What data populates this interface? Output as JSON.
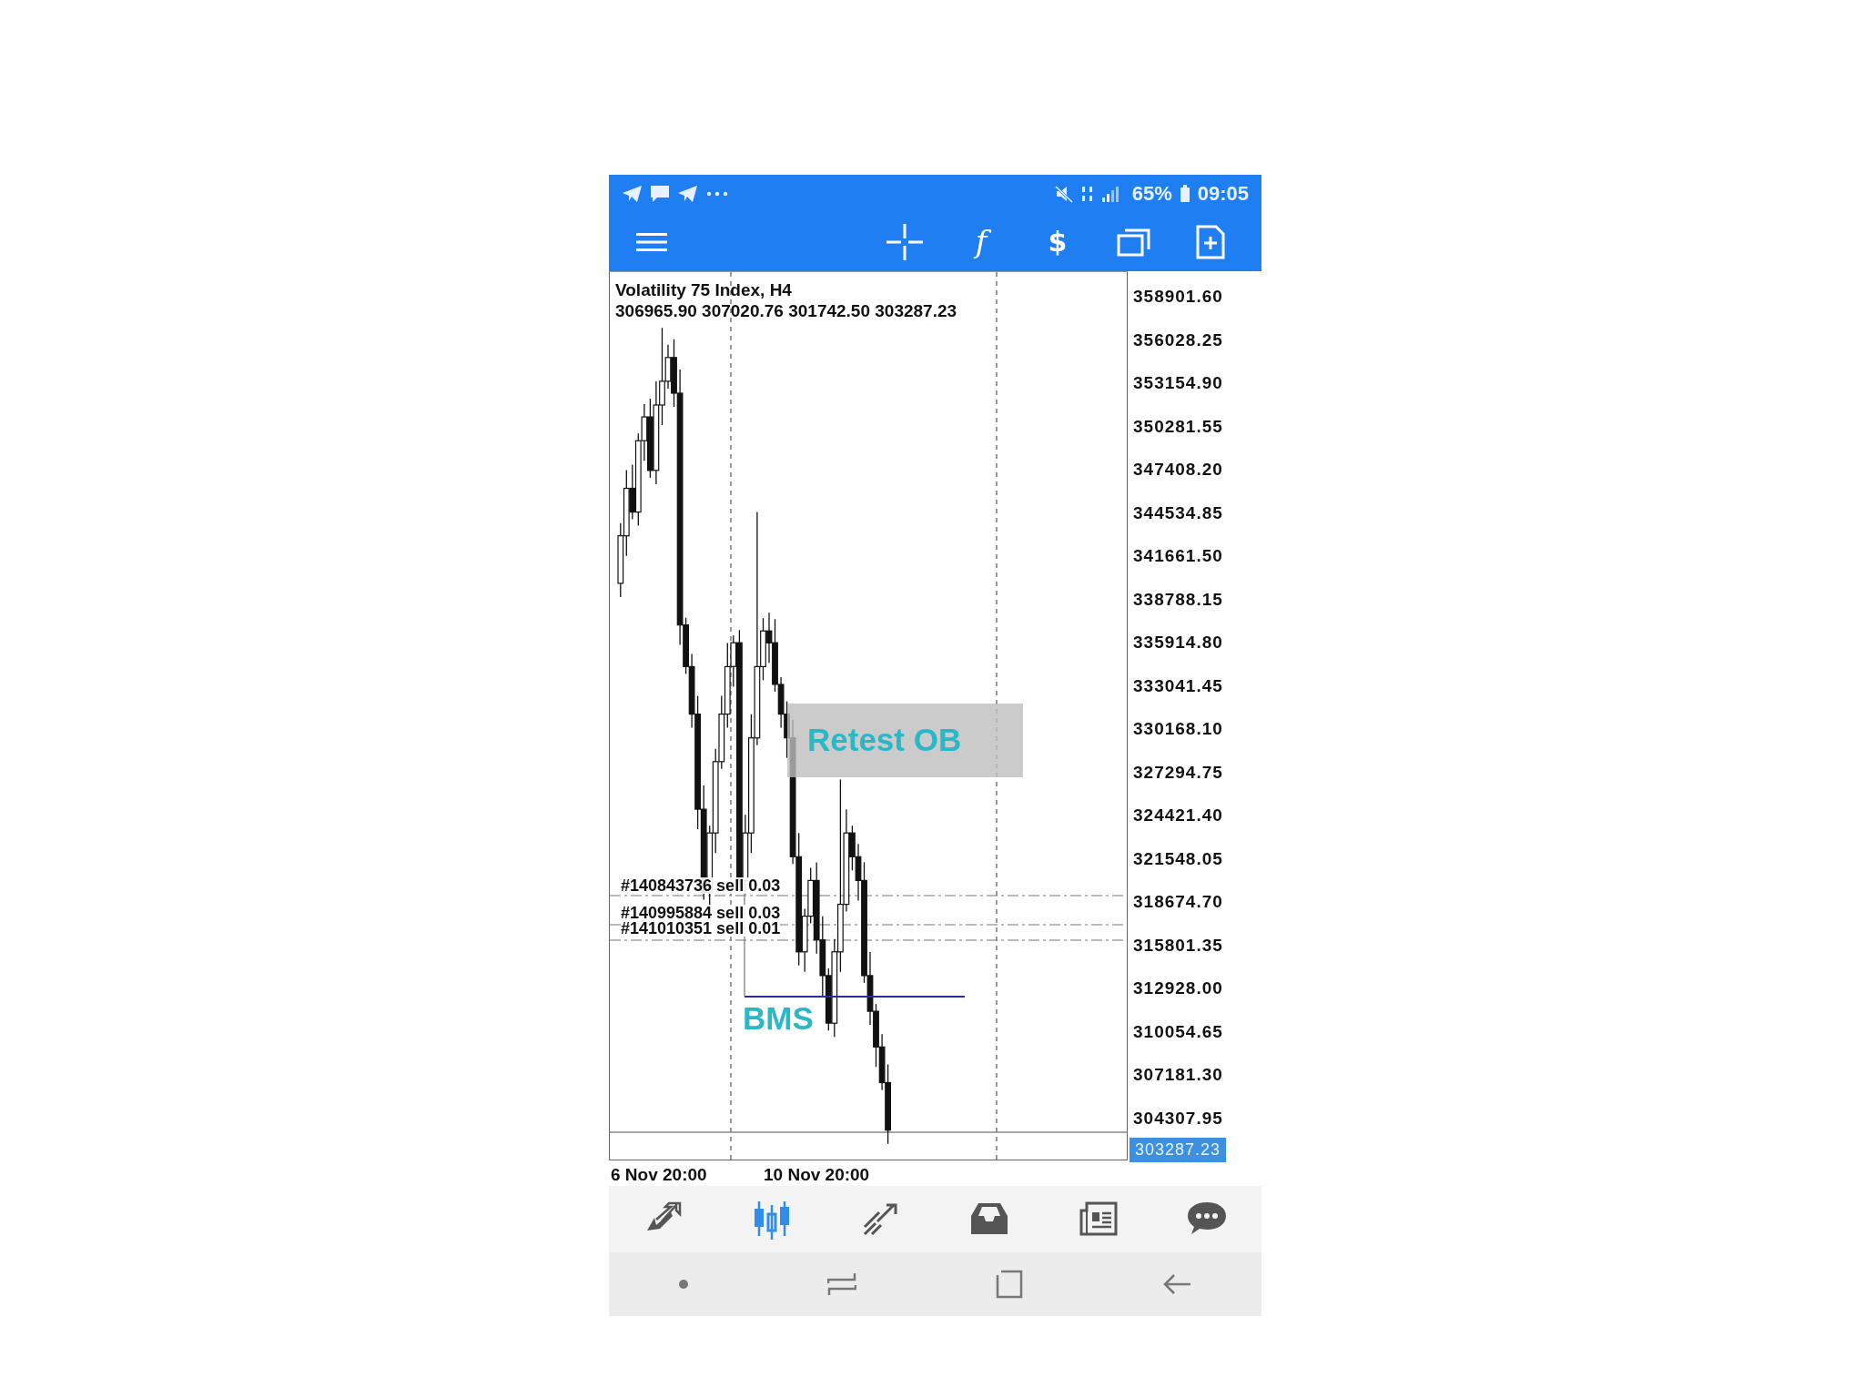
{
  "status_bar": {
    "battery": "65%",
    "time": "09:05"
  },
  "toolbar": [
    {
      "kind": "menu"
    },
    {
      "kind": "crosshair"
    },
    {
      "kind": "glyph",
      "text": "f"
    },
    {
      "kind": "trade",
      "text": "$"
    },
    {
      "kind": "windows"
    },
    {
      "kind": "new"
    }
  ],
  "chart": {
    "symbol": "Volatility 75 Index, H4",
    "ohlc": "306965.90 307020.76 301742.50 303287.23",
    "orders": [
      "#140843736 sell 0.03",
      "#140995884 sell 0.03",
      "#141010351 sell 0.01"
    ],
    "annotations": [
      {
        "kind": "box",
        "text": "Retest OB"
      },
      {
        "kind": "plain",
        "text": "BMS"
      }
    ],
    "price_axis": [
      "358901.60",
      "356028.25",
      "353154.90",
      "350281.55",
      "347408.20",
      "344534.85",
      "341661.50",
      "338788.15",
      "335914.80",
      "333041.45",
      "330168.10",
      "327294.75",
      "324421.40",
      "321548.05",
      "318674.70",
      "315801.35",
      "312928.00",
      "310054.65",
      "307181.30",
      "304307.95"
    ],
    "current_price": "303287.23",
    "time_axis": [
      "6 Nov 20:00",
      "10 Nov 20:00"
    ]
  },
  "tabs": [
    {
      "kind": "quotes",
      "selected": false
    },
    {
      "kind": "chart",
      "selected": true
    },
    {
      "kind": "trade",
      "selected": false
    },
    {
      "kind": "history",
      "selected": false
    },
    {
      "kind": "news",
      "selected": false
    },
    {
      "kind": "chat",
      "selected": false
    }
  ]
}
